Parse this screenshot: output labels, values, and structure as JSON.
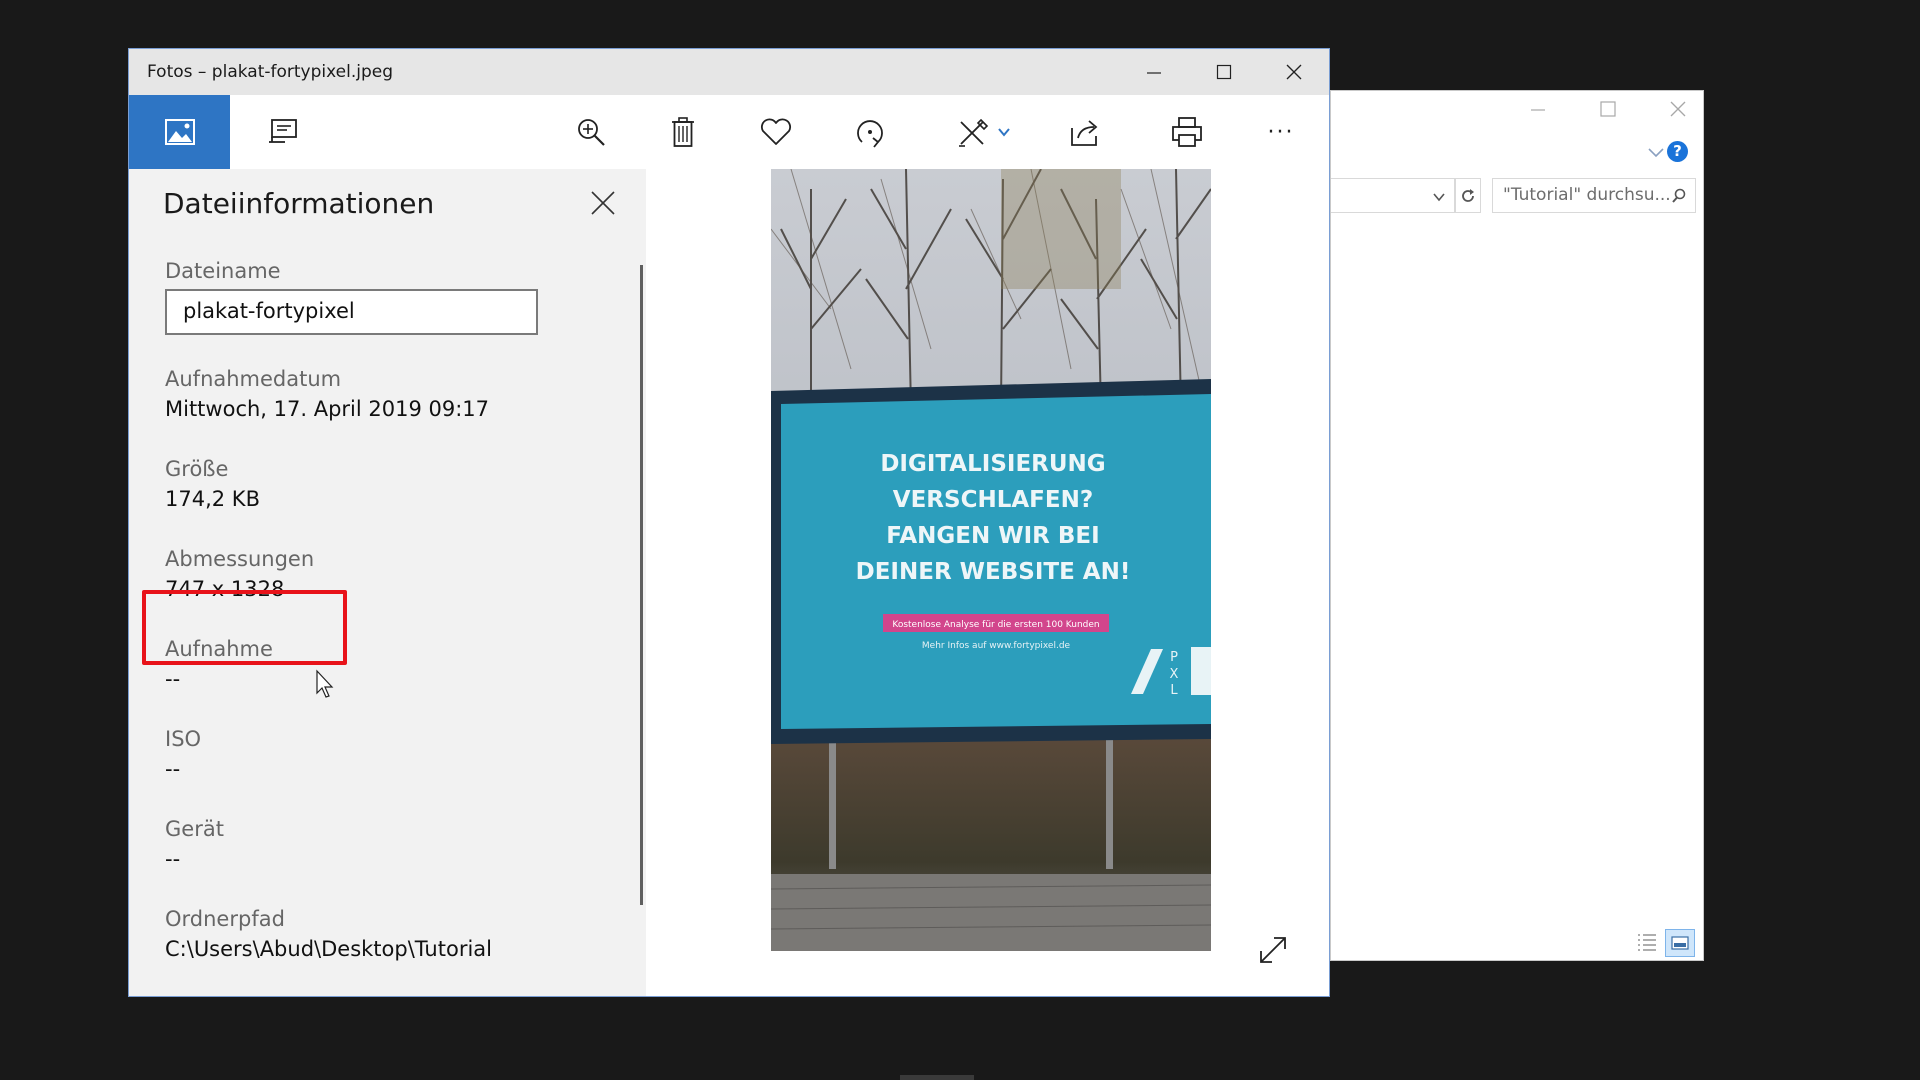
{
  "explorer": {
    "search_placeholder": "\"Tutorial\" durchsu...",
    "help_label": "?"
  },
  "photos": {
    "window_title": "Fotos – plakat-fortypixel.jpeg",
    "toolbar": {
      "icons": [
        "photo-icon",
        "slideshow-icon",
        "zoom-in-icon",
        "delete-icon",
        "heart-icon",
        "rotate-icon",
        "edit-draw-icon",
        "share-icon",
        "print-icon",
        "more-icon"
      ],
      "more_label": "···"
    },
    "accent_color": "#2e75c4",
    "info_panel": {
      "title": "Dateiinformationen",
      "fields": [
        {
          "label": "Dateiname",
          "value": "plakat-fortypixel"
        },
        {
          "label": "Aufnahmedatum",
          "value": "Mittwoch, 17. April 2019 09:17"
        },
        {
          "label": "Größe",
          "value": "174,2 KB"
        },
        {
          "label": "Abmessungen",
          "value": "747 x 1328"
        },
        {
          "label": "Aufnahme",
          "value": "--"
        },
        {
          "label": "ISO",
          "value": "--"
        },
        {
          "label": "Gerät",
          "value": "--"
        },
        {
          "label": "Ordnerpfad",
          "value": "C:\\Users\\Abud\\Desktop\\Tutorial"
        }
      ]
    },
    "billboard": {
      "line1": "DIGITALISIERUNG",
      "line2": "VERSCHLAFEN?",
      "line3": "FANGEN WIR BEI",
      "line4": "DEINER WEBSITE AN!",
      "tagline": "Kostenlose Analyse für die ersten 100 Kunden",
      "info": "Mehr Infos auf www.fortypixel.de",
      "logo_letters": [
        "P",
        "X",
        "L"
      ]
    }
  }
}
